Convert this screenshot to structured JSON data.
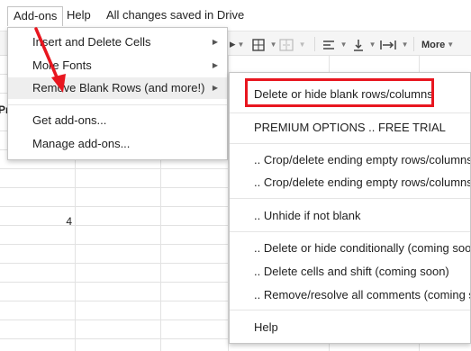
{
  "menubar": {
    "addons": "Add-ons",
    "help": "Help",
    "status": "All changes saved in Drive"
  },
  "toolbar": {
    "more": "More",
    "icons": [
      "fill-color-icon",
      "borders-icon",
      "merge-cells-icon",
      "align-icon",
      "valign-icon",
      "text-wrap-icon"
    ]
  },
  "grid": {
    "partial_text": "Pr",
    "cell_value": "4"
  },
  "addons_menu": {
    "items": [
      "Insert and Delete Cells",
      "More Fonts",
      "Remove Blank Rows (and more!)",
      "Get add-ons...",
      "Manage add-ons..."
    ]
  },
  "submenu": {
    "items": [
      "Delete or hide blank rows/columns",
      "PREMIUM OPTIONS .. FREE TRIAL",
      ".. Crop/delete ending empty rows/columns: th",
      ".. Crop/delete ending empty rows/columns: A",
      ".. Unhide if not blank",
      ".. Delete or hide conditionally (coming soon)",
      ".. Delete cells and shift (coming soon)",
      ".. Remove/resolve all comments (coming soo",
      "Help"
    ]
  },
  "colors": {
    "annotation_red": "#e8161f",
    "menu_highlight": "#eeeeee"
  }
}
